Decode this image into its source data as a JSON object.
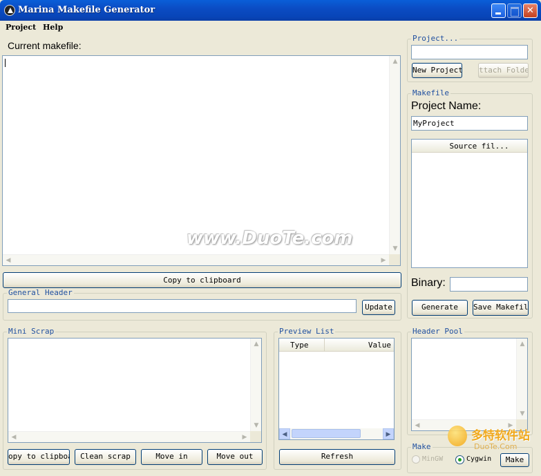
{
  "window": {
    "title": "Marina Makefile Generator",
    "accent_color": "#0b4cc4",
    "close_color": "#c4401f"
  },
  "menu": {
    "items": [
      "Project",
      "Help"
    ]
  },
  "editor": {
    "label": "Current makefile:",
    "value": "",
    "copy_button": "Copy to clipboard"
  },
  "general_header": {
    "title": "General Header",
    "value": "",
    "update_button": "Update"
  },
  "mini_scrap": {
    "title": "Mini Scrap",
    "buttons": [
      "opy to clipboar",
      "Clean scrap",
      "Move in",
      "Move out"
    ]
  },
  "preview_list": {
    "title": "Preview List",
    "columns": [
      "Type",
      "Value"
    ],
    "refresh_button": "Refresh"
  },
  "project": {
    "title": "Project...",
    "value": "",
    "new_button": "New Project",
    "attach_button": "ttach Folde"
  },
  "makefile": {
    "title": "Makefile",
    "project_name_label": "Project Name:",
    "project_name_value": "MyProject",
    "source_files_header": "Source fil...",
    "binary_label": "Binary:",
    "binary_value": "",
    "generate_button": "Generate",
    "save_button": "Save Makefile"
  },
  "header_pool": {
    "title": "Header Pool"
  },
  "make": {
    "title": "Make",
    "options": [
      "MinGW",
      "Cygwin"
    ],
    "selected": "Cygwin",
    "make_button": "Make"
  },
  "watermark": {
    "text": "www.DuoTe.com",
    "corner_brand": "多特软件站",
    "corner_url": "DuoTe.Com"
  }
}
